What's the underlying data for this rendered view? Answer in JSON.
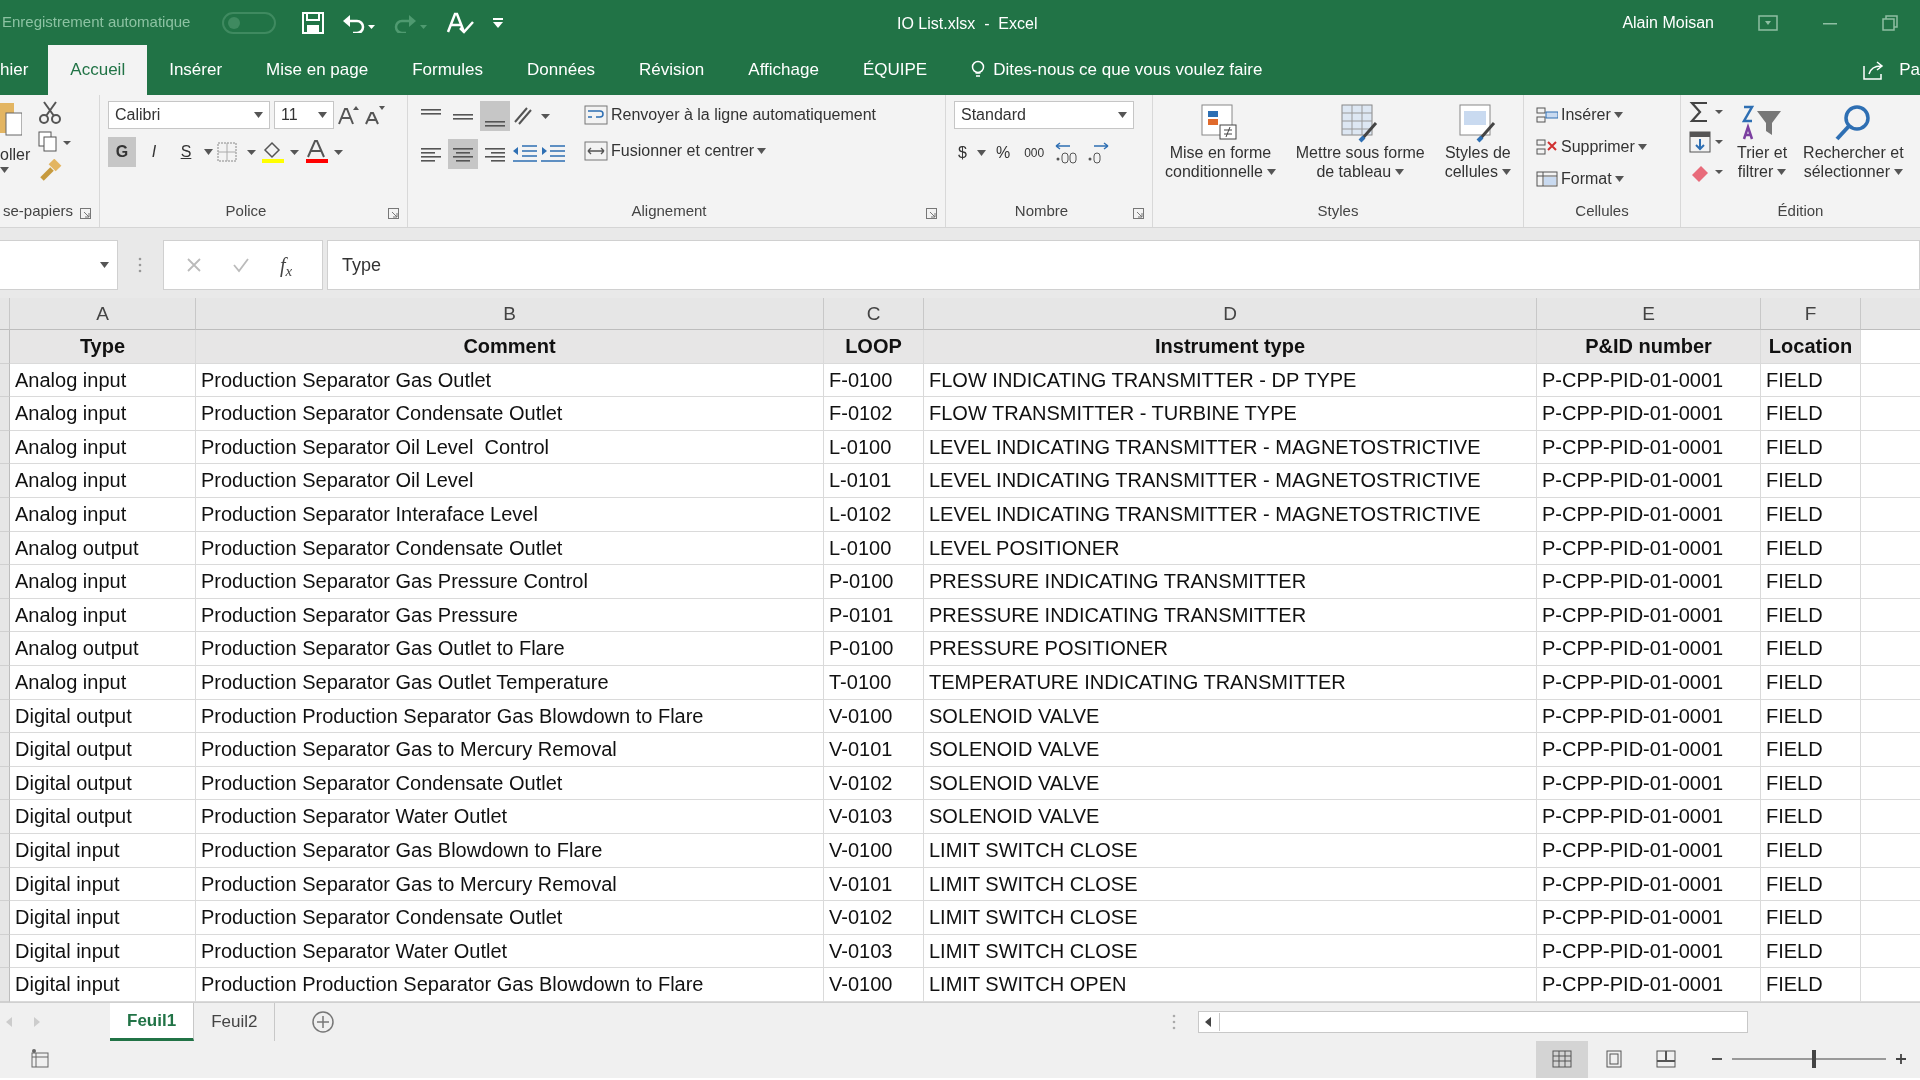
{
  "title_bar": {
    "autosave": "Enregistrement automatique",
    "autosave_on": false,
    "title": "IO List.xlsx  -  Excel",
    "user": "Alain Moisan"
  },
  "ribbon_tabs": [
    {
      "label": "hier",
      "selected": false
    },
    {
      "label": "Accueil",
      "selected": true
    },
    {
      "label": "Insérer",
      "selected": false
    },
    {
      "label": "Mise en page",
      "selected": false
    },
    {
      "label": "Formules",
      "selected": false
    },
    {
      "label": "Données",
      "selected": false
    },
    {
      "label": "Révision",
      "selected": false
    },
    {
      "label": "Affichage",
      "selected": false
    },
    {
      "label": "ÉQUIPE",
      "selected": false
    }
  ],
  "tell_me": "Dites-nous ce que vous voulez faire",
  "share_label": "Pa",
  "ribbon": {
    "clipboard": {
      "paste_label": "oller",
      "group": "se-papiers"
    },
    "font": {
      "group": "Police",
      "font_name": "Calibri",
      "font_size": "11",
      "styles": [
        {
          "label": "G",
          "pressed": true
        },
        {
          "label": "I",
          "pressed": false
        },
        {
          "label": "S",
          "pressed": false
        }
      ]
    },
    "alignment": {
      "group": "Alignement",
      "vertical": [
        {
          "pressed": false
        },
        {
          "pressed": false
        },
        {
          "pressed": true
        }
      ],
      "horizontal": [
        {
          "pressed": false
        },
        {
          "pressed": true
        },
        {
          "pressed": false
        }
      ],
      "wrap": "Renvoyer à la ligne automatiquement",
      "merge": "Fusionner et centrer"
    },
    "number": {
      "group": "Nombre",
      "format": "Standard",
      "currency": "$",
      "percent": "%",
      "thousands": "000"
    },
    "styles": {
      "group": "Styles",
      "buttons": [
        {
          "lines": [
            "Mise en forme",
            "conditionnelle"
          ]
        },
        {
          "lines": [
            "Mettre sous forme",
            "de tableau"
          ]
        },
        {
          "lines": [
            "Styles de",
            "cellules"
          ]
        }
      ]
    },
    "cells": {
      "group": "Cellules",
      "buttons": [
        "Insérer",
        "Supprimer",
        "Format"
      ]
    },
    "editing": {
      "group": "Édition",
      "buttons": [
        {
          "lines": [
            "Trier et",
            "filtrer"
          ]
        },
        {
          "lines": [
            "Rechercher et",
            "sélectionner"
          ]
        }
      ]
    }
  },
  "formula_bar": {
    "fx": "f$_{x}$",
    "value": "Type"
  },
  "sheet": {
    "columns": [
      "A",
      "B",
      "C",
      "D",
      "E",
      "F"
    ],
    "header_row": [
      "Type",
      "Comment",
      "LOOP",
      "Instrument type",
      "P&ID number",
      "Location"
    ],
    "rows": [
      [
        "Analog input",
        "Production Separator Gas Outlet",
        "F-0100",
        "FLOW INDICATING TRANSMITTER - DP TYPE",
        "P-CPP-PID-01-0001",
        "FIELD"
      ],
      [
        "Analog input",
        "Production Separator Condensate Outlet",
        "F-0102",
        "FLOW TRANSMITTER - TURBINE TYPE",
        "P-CPP-PID-01-0001",
        "FIELD"
      ],
      [
        "Analog input",
        "Production Separator Oil Level  Control",
        "L-0100",
        "LEVEL INDICATING TRANSMITTER - MAGNETOSTRICTIVE",
        "P-CPP-PID-01-0001",
        "FIELD"
      ],
      [
        "Analog input",
        "Production Separator Oil Level",
        "L-0101",
        "LEVEL INDICATING TRANSMITTER - MAGNETOSTRICTIVE",
        "P-CPP-PID-01-0001",
        "FIELD"
      ],
      [
        "Analog input",
        "Production Separator Interaface Level",
        "L-0102",
        "LEVEL INDICATING TRANSMITTER - MAGNETOSTRICTIVE",
        "P-CPP-PID-01-0001",
        "FIELD"
      ],
      [
        "Analog output",
        "Production Separator Condensate Outlet",
        "L-0100",
        "LEVEL POSITIONER",
        "P-CPP-PID-01-0001",
        "FIELD"
      ],
      [
        "Analog input",
        "Production Separator Gas Pressure Control",
        "P-0100",
        "PRESSURE INDICATING TRANSMITTER",
        "P-CPP-PID-01-0001",
        "FIELD"
      ],
      [
        "Analog input",
        "Production Separator Gas Pressure",
        "P-0101",
        "PRESSURE INDICATING TRANSMITTER",
        "P-CPP-PID-01-0001",
        "FIELD"
      ],
      [
        "Analog output",
        "Production Separator Gas Outlet to Flare",
        "P-0100",
        "PRESSURE POSITIONER",
        "P-CPP-PID-01-0001",
        "FIELD"
      ],
      [
        "Analog input",
        "Production Separator Gas Outlet Temperature",
        "T-0100",
        "TEMPERATURE INDICATING TRANSMITTER",
        "P-CPP-PID-01-0001",
        "FIELD"
      ],
      [
        "Digital output",
        "Production Production Separator Gas Blowdown to Flare",
        "V-0100",
        "SOLENOID VALVE",
        "P-CPP-PID-01-0001",
        "FIELD"
      ],
      [
        "Digital output",
        "Production Separator Gas to Mercury Removal",
        "V-0101",
        "SOLENOID VALVE",
        "P-CPP-PID-01-0001",
        "FIELD"
      ],
      [
        "Digital output",
        "Production Separator Condensate Outlet",
        "V-0102",
        "SOLENOID VALVE",
        "P-CPP-PID-01-0001",
        "FIELD"
      ],
      [
        "Digital output",
        "Production Separator Water Outlet",
        "V-0103",
        "SOLENOID VALVE",
        "P-CPP-PID-01-0001",
        "FIELD"
      ],
      [
        "Digital input",
        "Production Separator Gas Blowdown to Flare",
        "V-0100",
        "LIMIT SWITCH CLOSE",
        "P-CPP-PID-01-0001",
        "FIELD"
      ],
      [
        "Digital input",
        "Production Separator Gas to Mercury Removal",
        "V-0101",
        "LIMIT SWITCH CLOSE",
        "P-CPP-PID-01-0001",
        "FIELD"
      ],
      [
        "Digital input",
        "Production Separator Condensate Outlet",
        "V-0102",
        "LIMIT SWITCH CLOSE",
        "P-CPP-PID-01-0001",
        "FIELD"
      ],
      [
        "Digital input",
        "Production Separator Water Outlet",
        "V-0103",
        "LIMIT SWITCH CLOSE",
        "P-CPP-PID-01-0001",
        "FIELD"
      ],
      [
        "Digital input",
        "Production Production Separator Gas Blowdown to Flare",
        "V-0100",
        "LIMIT SWITCH OPEN",
        "P-CPP-PID-01-0001",
        "FIELD"
      ]
    ]
  },
  "sheet_tabs": [
    {
      "label": "Feuil1",
      "selected": true
    },
    {
      "label": "Feuil2",
      "selected": false
    }
  ],
  "status_bar": {
    "views": [
      {
        "selected": true
      },
      {
        "selected": false
      },
      {
        "selected": false
      }
    ],
    "zoom": {
      "level": 0.52
    }
  }
}
